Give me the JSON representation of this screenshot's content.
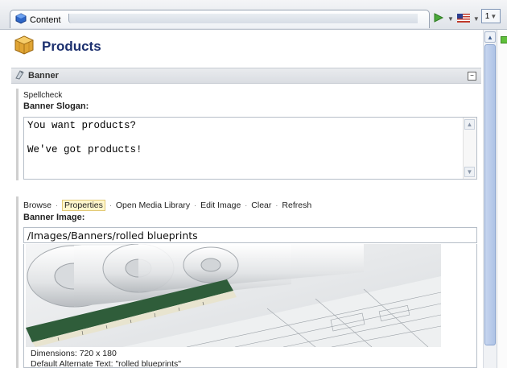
{
  "tab": {
    "label": "Content",
    "active_badge": "1"
  },
  "page": {
    "title": "Products"
  },
  "section": {
    "title": "Banner",
    "collapse_symbol": "−"
  },
  "slogan_field": {
    "spellcheck_label": "Spellcheck",
    "label": "Banner Slogan:",
    "value": "You want products?\n\nWe've got products!"
  },
  "image_field": {
    "toolbar": [
      "Browse",
      "Properties",
      "Open Media Library",
      "Edit Image",
      "Clear",
      "Refresh"
    ],
    "active_tool": "Properties",
    "label": "Banner Image:",
    "path": "/Images/Banners/rolled blueprints",
    "dimensions": "Dimensions: 720 x 180",
    "alt_text": "Default Alternate Text: \"rolled blueprints\""
  },
  "icons": {
    "tab": "cube-icon",
    "page": "boxes-icon",
    "section": "banner-icon",
    "tools": [
      "publish-icon",
      "language-flag-icon"
    ]
  },
  "colors": {
    "title": "#1b2f6e",
    "scroll_thumb": "#aec3e6"
  }
}
